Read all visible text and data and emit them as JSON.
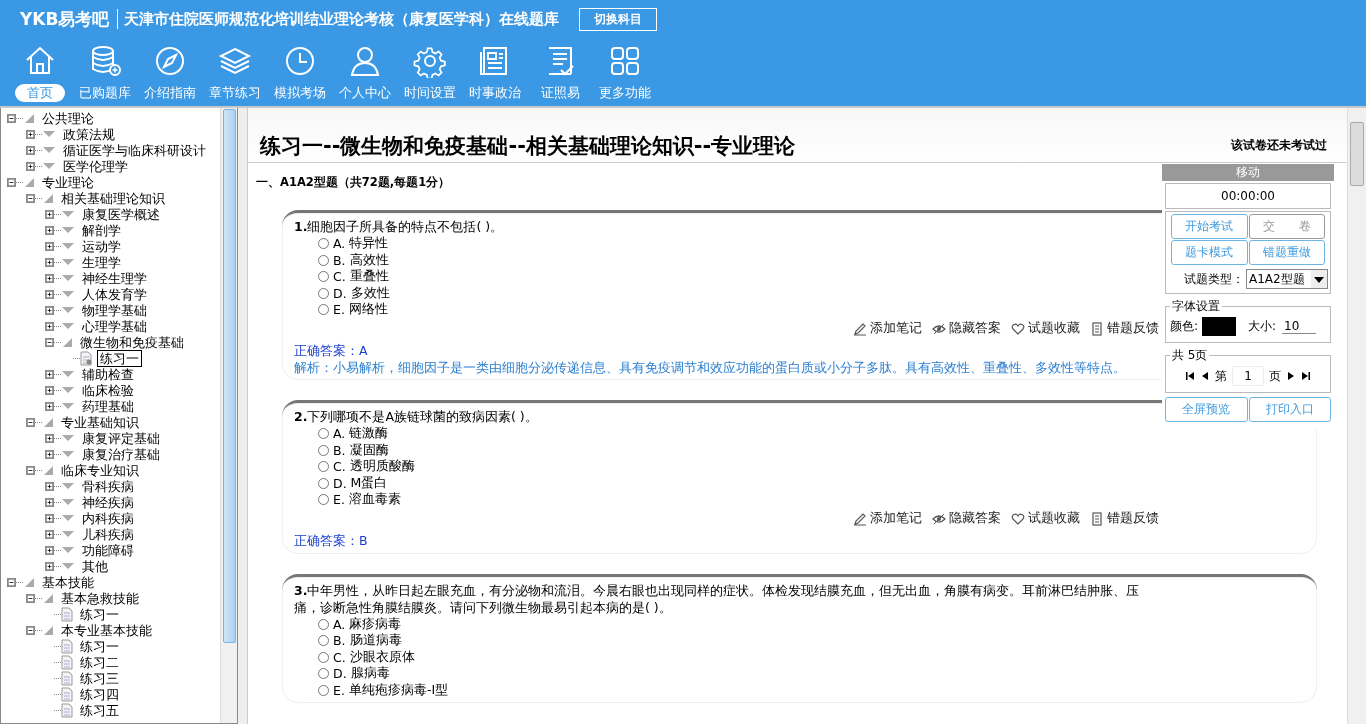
{
  "app": {
    "logo": "YKB易考吧",
    "title": "天津市住院医师规范化培训结业理论考核（康复医学科）在线题库",
    "switch_button": "切换科目"
  },
  "nav": [
    {
      "label": "首页",
      "selected": true
    },
    {
      "label": "已购题库",
      "selected": false
    },
    {
      "label": "介绍指南",
      "selected": false
    },
    {
      "label": "章节练习",
      "selected": false
    },
    {
      "label": "模拟考场",
      "selected": false
    },
    {
      "label": "个人中心",
      "selected": false
    },
    {
      "label": "时间设置",
      "selected": false
    },
    {
      "label": "时事政治",
      "selected": false
    },
    {
      "label": "证照易",
      "selected": false
    },
    {
      "label": "更多功能",
      "selected": false
    }
  ],
  "tree": [
    {
      "label": "公共理论",
      "kind": "group",
      "expanded": true,
      "selected": false,
      "children": [
        {
          "label": "政策法规",
          "kind": "group",
          "expanded": false,
          "selected": false
        },
        {
          "label": "循证医学与临床科研设计",
          "kind": "group",
          "expanded": false,
          "selected": false
        },
        {
          "label": "医学伦理学",
          "kind": "group",
          "expanded": false,
          "selected": false
        }
      ]
    },
    {
      "label": "专业理论",
      "kind": "group",
      "expanded": true,
      "selected": false,
      "children": [
        {
          "label": "相关基础理论知识",
          "kind": "group",
          "expanded": true,
          "selected": false,
          "children": [
            {
              "label": "康复医学概述",
              "kind": "group",
              "expanded": false,
              "selected": false
            },
            {
              "label": "解剖学",
              "kind": "group",
              "expanded": false,
              "selected": false
            },
            {
              "label": "运动学",
              "kind": "group",
              "expanded": false,
              "selected": false
            },
            {
              "label": "生理学",
              "kind": "group",
              "expanded": false,
              "selected": false
            },
            {
              "label": "神经生理学",
              "kind": "group",
              "expanded": false,
              "selected": false
            },
            {
              "label": "人体发育学",
              "kind": "group",
              "expanded": false,
              "selected": false
            },
            {
              "label": "物理学基础",
              "kind": "group",
              "expanded": false,
              "selected": false
            },
            {
              "label": "心理学基础",
              "kind": "group",
              "expanded": false,
              "selected": false
            },
            {
              "label": "微生物和免疫基础",
              "kind": "group",
              "expanded": true,
              "selected": false,
              "children": [
                {
                  "label": "练习一",
                  "kind": "exercise",
                  "selected": true
                }
              ]
            },
            {
              "label": "辅助检查",
              "kind": "group",
              "expanded": false,
              "selected": false
            },
            {
              "label": "临床检验",
              "kind": "group",
              "expanded": false,
              "selected": false
            },
            {
              "label": "药理基础",
              "kind": "group",
              "expanded": false,
              "selected": false
            }
          ]
        },
        {
          "label": "专业基础知识",
          "kind": "group",
          "expanded": true,
          "selected": false,
          "children": [
            {
              "label": "康复评定基础",
              "kind": "group",
              "expanded": false,
              "selected": false
            },
            {
              "label": "康复治疗基础",
              "kind": "group",
              "expanded": false,
              "selected": false
            }
          ]
        },
        {
          "label": "临床专业知识",
          "kind": "group",
          "expanded": true,
          "selected": false,
          "children": [
            {
              "label": "骨科疾病",
              "kind": "group",
              "expanded": false,
              "selected": false
            },
            {
              "label": "神经疾病",
              "kind": "group",
              "expanded": false,
              "selected": false
            },
            {
              "label": "内科疾病",
              "kind": "group",
              "expanded": false,
              "selected": false
            },
            {
              "label": "儿科疾病",
              "kind": "group",
              "expanded": false,
              "selected": false
            },
            {
              "label": "功能障碍",
              "kind": "group",
              "expanded": false,
              "selected": false
            },
            {
              "label": "其他",
              "kind": "group",
              "expanded": false,
              "selected": false
            }
          ]
        }
      ]
    },
    {
      "label": "基本技能",
      "kind": "group",
      "expanded": true,
      "selected": false,
      "children": [
        {
          "label": "基本急救技能",
          "kind": "group",
          "expanded": true,
          "selected": false,
          "children": [
            {
              "label": "练习一",
              "kind": "exercise",
              "selected": false
            }
          ]
        },
        {
          "label": "本专业基本技能",
          "kind": "group",
          "expanded": true,
          "selected": false,
          "children": [
            {
              "label": "练习一",
              "kind": "exercise",
              "selected": false
            },
            {
              "label": "练习二",
              "kind": "exercise",
              "selected": false
            },
            {
              "label": "练习三",
              "kind": "exercise",
              "selected": false
            },
            {
              "label": "练习四",
              "kind": "exercise",
              "selected": false
            },
            {
              "label": "练习五",
              "kind": "exercise",
              "selected": false
            }
          ]
        }
      ]
    }
  ],
  "paper": {
    "title": "练习一--微生物和免疫基础--相关基础理论知识--专业理论",
    "status": "该试卷还未考试过",
    "section": "一、A1A2型题（共72题,每题1分）"
  },
  "questions": [
    {
      "number": "1.",
      "text": "细胞因子所具备的特点不包括( )。",
      "options": [
        {
          "letter": "A.",
          "text": "特异性",
          "selected": false
        },
        {
          "letter": "B.",
          "text": "高效性",
          "selected": false
        },
        {
          "letter": "C.",
          "text": "重叠性",
          "selected": false
        },
        {
          "letter": "D.",
          "text": "多效性",
          "selected": false
        },
        {
          "letter": "E.",
          "text": "网络性",
          "selected": false
        }
      ],
      "actions": [
        "添加笔记",
        "隐藏答案",
        "试题收藏",
        "错题反馈"
      ],
      "answer": "正确答案：A",
      "analysis": "解析：小易解析，细胞因子是一类由细胞分泌传递信息、具有免疫调节和效应功能的蛋白质或小分子多肽。具有高效性、重叠性、多效性等特点。"
    },
    {
      "number": "2.",
      "text": "下列哪项不是A族链球菌的致病因素( )。",
      "options": [
        {
          "letter": "A.",
          "text": "链激酶",
          "selected": false
        },
        {
          "letter": "B.",
          "text": "凝固酶",
          "selected": false
        },
        {
          "letter": "C.",
          "text": "透明质酸酶",
          "selected": false
        },
        {
          "letter": "D.",
          "text": "M蛋白",
          "selected": false
        },
        {
          "letter": "E.",
          "text": "溶血毒素",
          "selected": false
        }
      ],
      "actions": [
        "添加笔记",
        "隐藏答案",
        "试题收藏",
        "错题反馈"
      ],
      "answer": "正确答案：B"
    },
    {
      "number": "3.",
      "text": "中年男性，从昨日起左眼充血，有分泌物和流泪。今晨右眼也出现同样的症状。体检发现结膜充血，但无出血，角膜有病变。耳前淋巴结肿胀、压痛，诊断急性角膜结膜炎。请问下列微生物最易引起本病的是( )。",
      "options": [
        {
          "letter": "A.",
          "text": "麻疹病毒",
          "selected": false
        },
        {
          "letter": "B.",
          "text": "肠道病毒",
          "selected": false
        },
        {
          "letter": "C.",
          "text": "沙眼衣原体",
          "selected": false
        },
        {
          "letter": "D.",
          "text": "腺病毒",
          "selected": false
        },
        {
          "letter": "E.",
          "text": "单纯疱疹病毒-Ⅰ型",
          "selected": false
        }
      ]
    }
  ],
  "panel": {
    "header": "移动",
    "timer": "00:00:00",
    "buttons": [
      {
        "label": "开始考试",
        "disabled": false
      },
      {
        "label": "交　　卷",
        "disabled": true
      },
      {
        "label": "题卡模式",
        "disabled": false
      },
      {
        "label": "错题重做",
        "disabled": false
      }
    ],
    "type_label": "试题类型：",
    "type_value": "A1A2型题",
    "font_legend": "字体设置",
    "color_label": "颜色:",
    "color": "#000000",
    "size_label": "大小:",
    "size_value": "10",
    "pager_legend": "共 5页",
    "page_prefix": "第",
    "page_value": "1",
    "page_suffix": "页",
    "bottom_buttons": [
      {
        "label": "全屏预览",
        "disabled": false
      },
      {
        "label": "打印入口",
        "disabled": false
      }
    ]
  }
}
